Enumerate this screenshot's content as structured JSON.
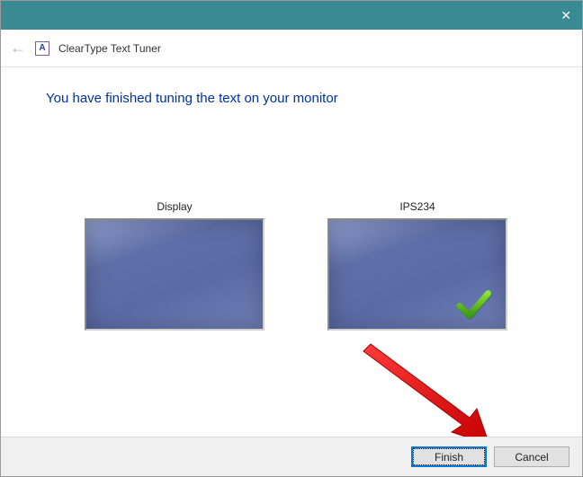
{
  "window": {
    "title": "ClearType Text Tuner"
  },
  "heading": "You have finished tuning the text on your monitor",
  "monitors": {
    "left": {
      "label": "Display",
      "checked": false
    },
    "right": {
      "label": "IPS234",
      "checked": true
    }
  },
  "buttons": {
    "finish": "Finish",
    "cancel": "Cancel"
  }
}
